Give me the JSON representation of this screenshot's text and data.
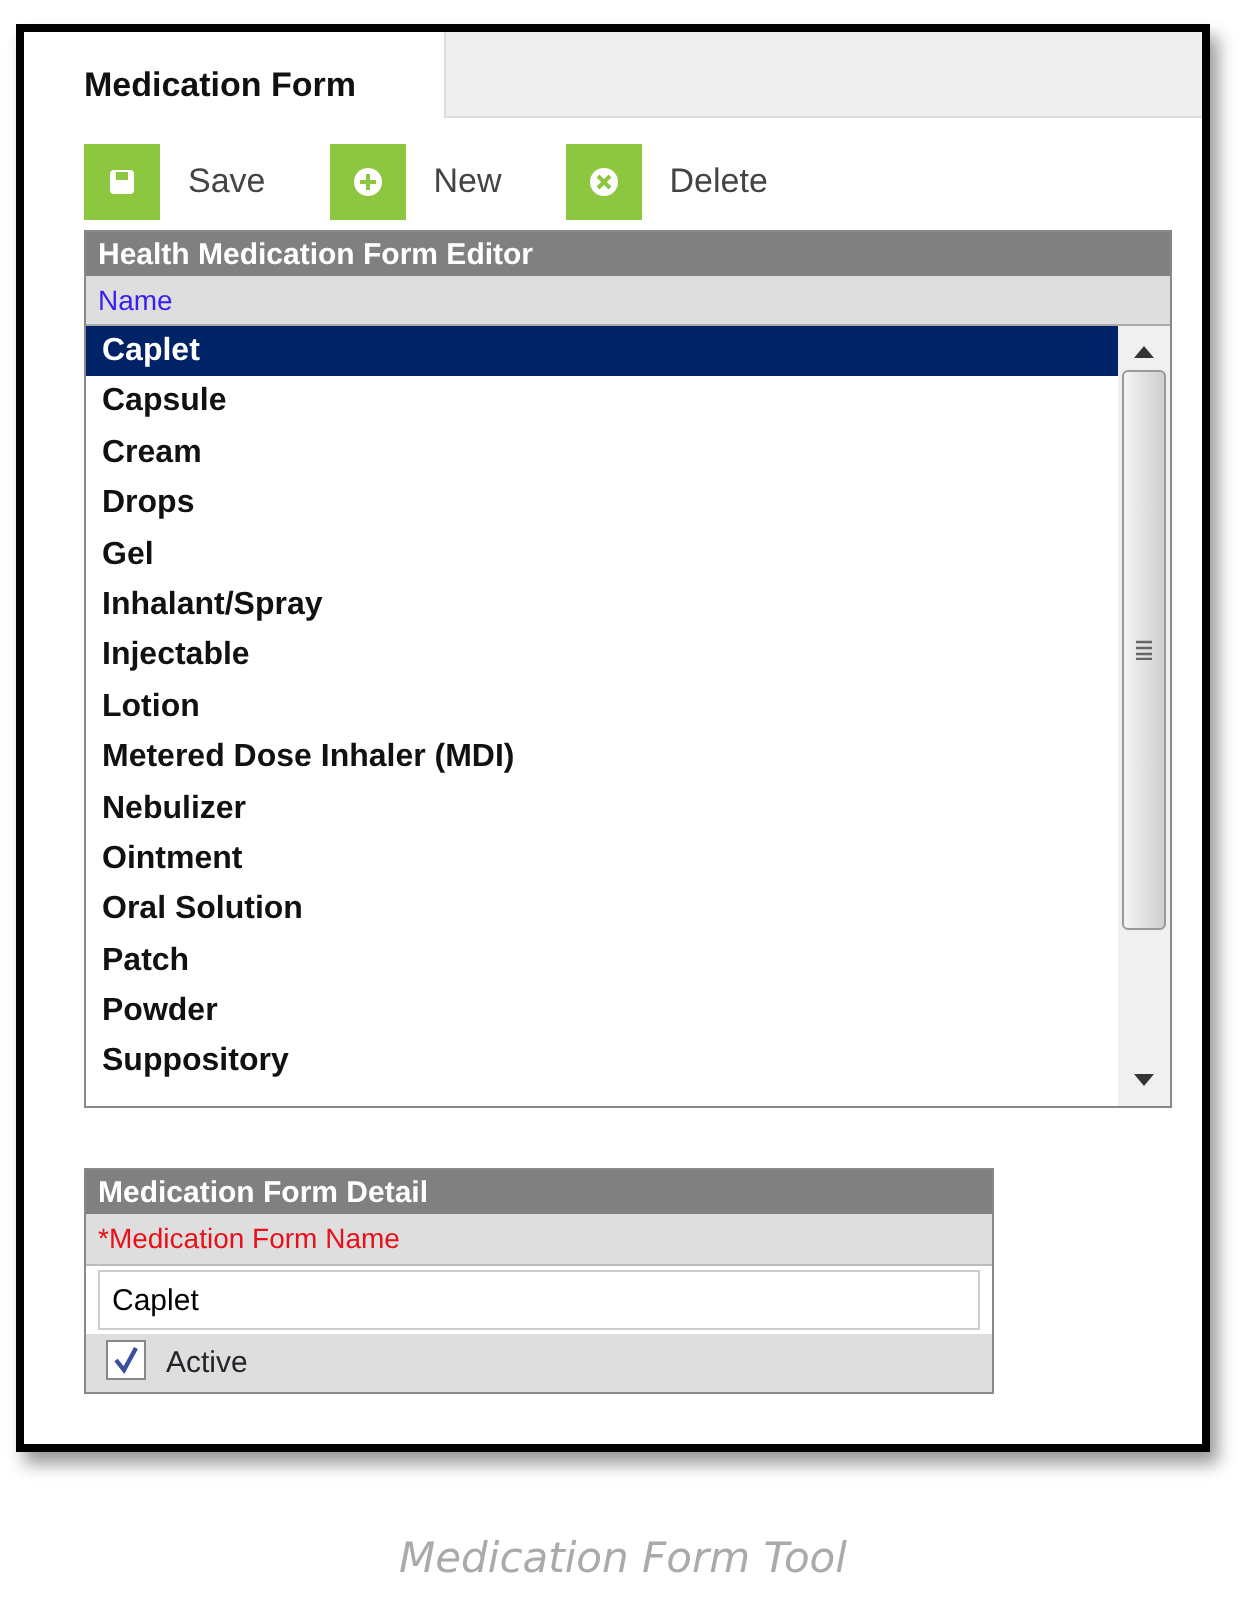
{
  "tabs": [
    {
      "label": "Medication Form",
      "selected": true
    }
  ],
  "toolbar": [
    {
      "label": "Save",
      "kind": "save"
    },
    {
      "label": "New",
      "kind": "new"
    },
    {
      "label": "Delete",
      "kind": "delete"
    }
  ],
  "editor": {
    "title": "Health Medication Form Editor",
    "column": "Name",
    "rows": [
      {
        "name": "Caplet",
        "selected": true
      },
      {
        "name": "Capsule",
        "selected": false
      },
      {
        "name": "Cream",
        "selected": false
      },
      {
        "name": "Drops",
        "selected": false
      },
      {
        "name": "Gel",
        "selected": false
      },
      {
        "name": "Inhalant/Spray",
        "selected": false
      },
      {
        "name": "Injectable",
        "selected": false
      },
      {
        "name": "Lotion",
        "selected": false
      },
      {
        "name": "Metered Dose Inhaler (MDI)",
        "selected": false
      },
      {
        "name": "Nebulizer",
        "selected": false
      },
      {
        "name": "Ointment",
        "selected": false
      },
      {
        "name": "Oral Solution",
        "selected": false
      },
      {
        "name": "Patch",
        "selected": false
      },
      {
        "name": "Powder",
        "selected": false
      },
      {
        "name": "Suppository",
        "selected": false
      }
    ]
  },
  "detail": {
    "title": "Medication Form Detail",
    "field_label": "*Medication Form Name",
    "field_value": "Caplet",
    "active_label": "Active",
    "active_checked": true
  },
  "caption": "Medication Form Tool"
}
